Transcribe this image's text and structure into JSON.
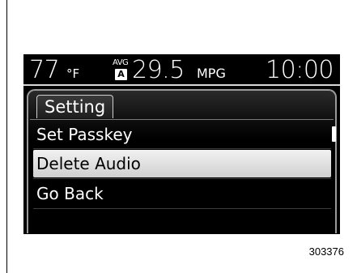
{
  "status_bar": {
    "temperature": "77",
    "temperature_unit": "°F",
    "avg_label": "AVG",
    "avg_mode": "A",
    "fuel_economy": "29.5",
    "fuel_economy_unit": "MPG",
    "clock": "10:00"
  },
  "menu": {
    "title": "Setting",
    "items": [
      {
        "label": "Set Passkey",
        "selected": false
      },
      {
        "label": "Delete Audio",
        "selected": true
      },
      {
        "label": "Go Back",
        "selected": false
      }
    ]
  },
  "figure_number": "303376"
}
